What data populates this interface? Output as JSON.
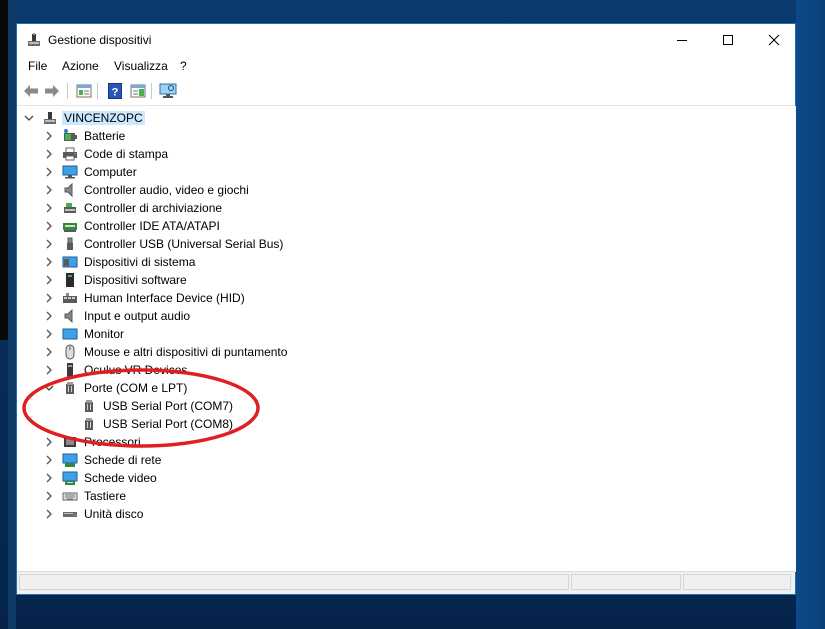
{
  "window": {
    "title": "Gestione dispositivi"
  },
  "menu": [
    "File",
    "Azione",
    "Visualizza",
    "?"
  ],
  "toolbar": {
    "buttons": [
      "back-arrow-icon",
      "forward-arrow-icon",
      "properties-icon",
      "help-icon",
      "action-pane-icon",
      "monitor-scan-icon"
    ]
  },
  "tree": {
    "root": "VINCENZOPC",
    "categories": [
      {
        "label": "Batterie",
        "icon": "battery-icon"
      },
      {
        "label": "Code di stampa",
        "icon": "printer-icon"
      },
      {
        "label": "Computer",
        "icon": "computer-icon"
      },
      {
        "label": "Controller audio, video e giochi",
        "icon": "speaker-icon"
      },
      {
        "label": "Controller di archiviazione",
        "icon": "storage-controller-icon"
      },
      {
        "label": "Controller IDE ATA/ATAPI",
        "icon": "ide-controller-icon"
      },
      {
        "label": "Controller USB (Universal Serial Bus)",
        "icon": "usb-icon"
      },
      {
        "label": "Dispositivi di sistema",
        "icon": "system-device-icon"
      },
      {
        "label": "Dispositivi software",
        "icon": "software-device-icon"
      },
      {
        "label": "Human Interface Device (HID)",
        "icon": "hid-icon"
      },
      {
        "label": "Input e output audio",
        "icon": "speaker-icon"
      },
      {
        "label": "Monitor",
        "icon": "monitor-icon"
      },
      {
        "label": "Mouse e altri dispositivi di puntamento",
        "icon": "mouse-icon"
      },
      {
        "label": "Oculus VR Devices",
        "icon": "vr-device-icon"
      },
      {
        "label": "Porte (COM e LPT)",
        "icon": "port-icon",
        "expanded": true,
        "children": [
          "USB Serial Port (COM7)",
          "USB Serial Port (COM8)"
        ]
      },
      {
        "label": "Processori",
        "icon": "processor-icon"
      },
      {
        "label": "Schede di rete",
        "icon": "network-adapter-icon"
      },
      {
        "label": "Schede video",
        "icon": "display-adapter-icon"
      },
      {
        "label": "Tastiere",
        "icon": "keyboard-icon"
      },
      {
        "label": "Unità disco",
        "icon": "disk-drive-icon"
      }
    ]
  },
  "colors": {
    "selection": "#cce8ff",
    "annotation": "#e02020",
    "window_border": "#1e6fb8",
    "desktop": "#0b3a6e"
  }
}
